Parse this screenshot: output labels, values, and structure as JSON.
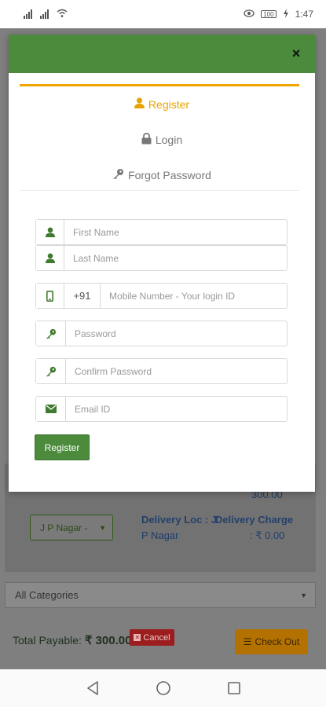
{
  "status_bar": {
    "time": "1:47",
    "battery": "100",
    "signal_icons": [
      "signal-icon",
      "signal-icon",
      "wifi-icon"
    ],
    "right_icons": [
      "eye-icon",
      "battery-icon",
      "charging-icon"
    ]
  },
  "modal": {
    "close_label": "×",
    "tabs": {
      "register": "Register",
      "login": "Login",
      "forgot": "Forgot Password"
    },
    "form": {
      "first_name_placeholder": "First Name",
      "last_name_placeholder": "Last Name",
      "country_code": "+91",
      "mobile_placeholder": "Mobile Number - Your login ID",
      "password_placeholder": "Password",
      "confirm_password_placeholder": "Confirm Password",
      "email_placeholder": "Email ID",
      "submit_label": "Register"
    }
  },
  "background": {
    "amount": "300.00",
    "location_select": "J P Nagar -",
    "delivery_loc_label": "Delivery Loc : J",
    "delivery_loc_value": "P Nagar",
    "delivery_charge_label": "Delivery Charge",
    "delivery_charge_value": ": ₹ 0.00",
    "categories_select": "All Categories",
    "total_label": "Total Payable:",
    "total_value": "₹ 300.00",
    "cancel_label": "Cancel",
    "checkout_label": "Check Out"
  },
  "colors": {
    "green": "#4b8b3b",
    "orange": "#e9a300",
    "checkout": "#b27100",
    "cancel": "#9b1d1d"
  }
}
